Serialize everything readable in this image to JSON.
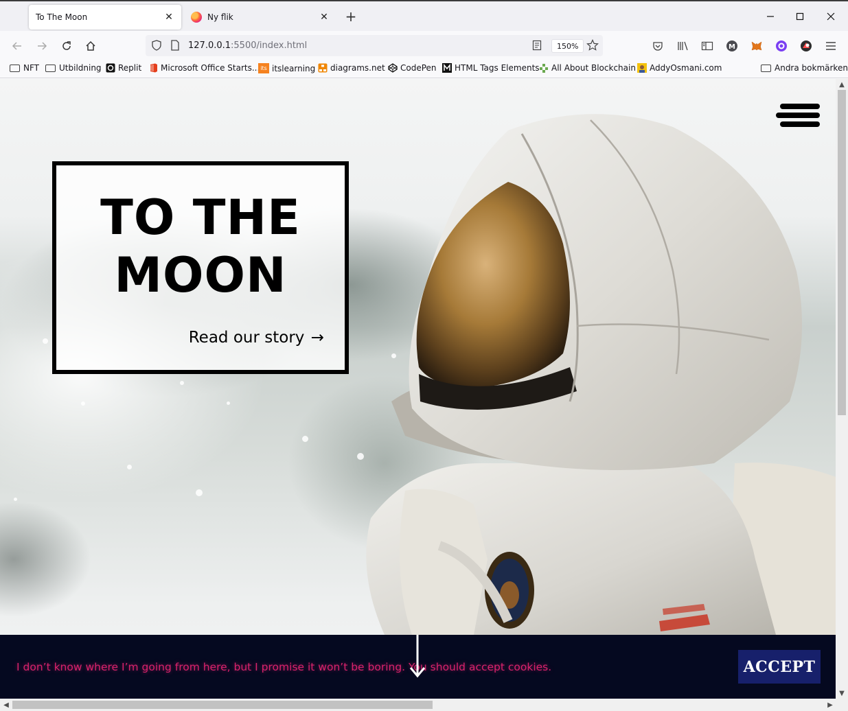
{
  "browser": {
    "tabs": [
      {
        "title": "To The Moon",
        "active": true
      },
      {
        "title": "Ny flik",
        "active": false
      }
    ],
    "new_tab_label": "+",
    "url_host": "127.0.0.1",
    "url_rest": ":5500/index.html",
    "zoom": "150%",
    "bookmarks": [
      {
        "label": "NFT",
        "icon": "folder-icon"
      },
      {
        "label": "Utbildning",
        "icon": "folder-icon"
      },
      {
        "label": "Replit",
        "icon": "replit-icon"
      },
      {
        "label": "Microsoft Office Starts...",
        "icon": "office-icon"
      },
      {
        "label": "itslearning",
        "icon": "itslearning-icon"
      },
      {
        "label": "diagrams.net",
        "icon": "diagrams-icon"
      },
      {
        "label": "CodePen",
        "icon": "codepen-icon"
      },
      {
        "label": "HTML Tags Elements",
        "icon": "html-tags-icon"
      },
      {
        "label": "All About Blockchain",
        "icon": "blockchain-icon"
      },
      {
        "label": "AddyOsmani.com",
        "icon": "addy-icon"
      }
    ],
    "other_bookmarks": "Andra bokmärken",
    "itslearning_badge": "its"
  },
  "page": {
    "hero_title_line1": "TO THE",
    "hero_title_line2": "MOON",
    "hero_link": "Read our story",
    "hero_link_arrow": "→",
    "cookie_text": "I don’t know where I’m going from here, but I promise it won’t be boring. You should accept cookies.",
    "accept_label": "ACCEPT"
  },
  "colors": {
    "cookie_bg": "#050920",
    "cookie_text": "#d8226c",
    "accept_bg": "#17206b"
  }
}
